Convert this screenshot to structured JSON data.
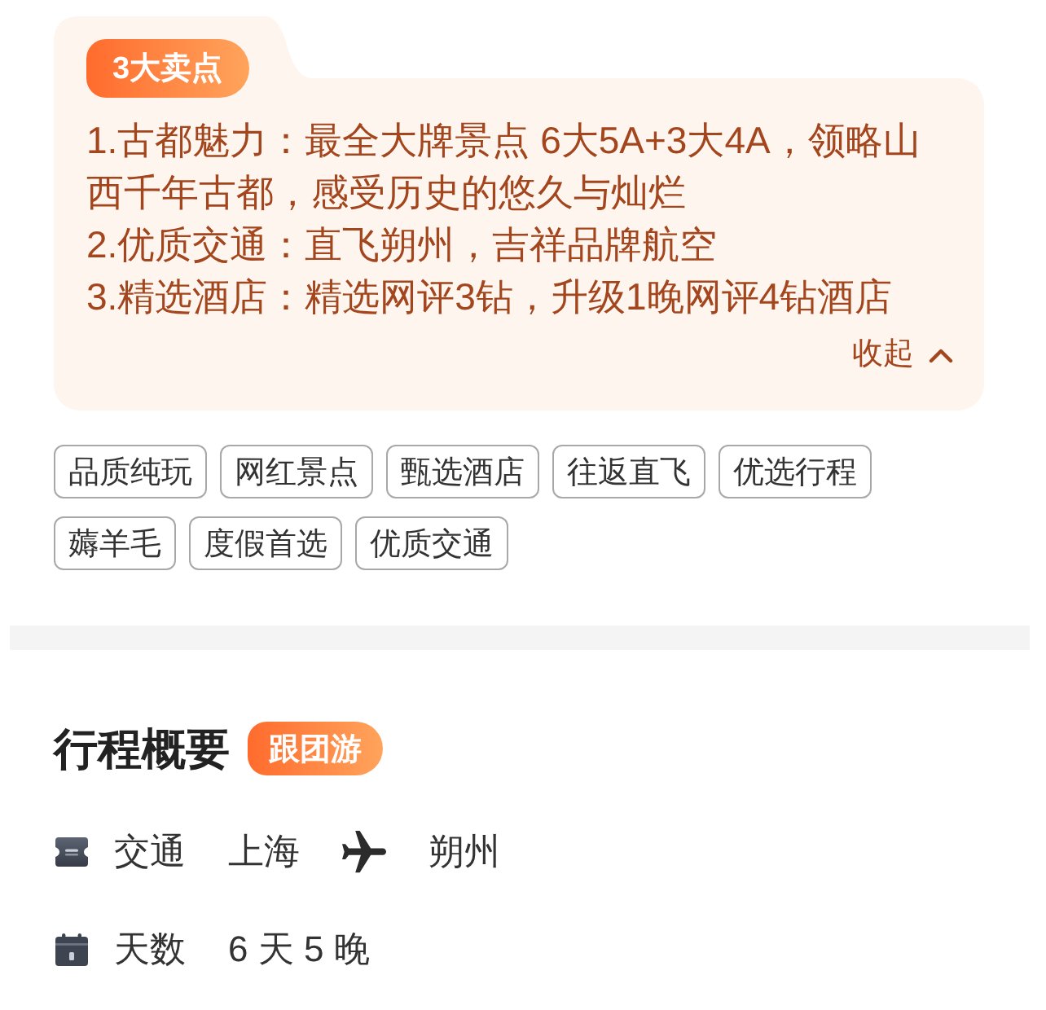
{
  "highlights": {
    "badge": "3大卖点",
    "points": [
      "1.古都魅力：最全大牌景点 6大5A+3大4A，领略山西千年古都，感受历史的悠久与灿烂",
      "2.优质交通：直飞朔州，吉祥品牌航空",
      "3.精选酒店：精选网评3钻，升级1晚网评4钻酒店"
    ],
    "toggle": {
      "label": "收起",
      "expanded": true
    }
  },
  "tags": [
    "品质纯玩",
    "网红景点",
    "甄选酒店",
    "往返直飞",
    "优选行程",
    "薅羊毛",
    "度假首选",
    "优质交通"
  ],
  "overview": {
    "title": "行程概要",
    "badge": "跟团游",
    "rows": [
      {
        "kind": "transport",
        "label": "交通",
        "from": "上海",
        "to": "朔州"
      },
      {
        "kind": "duration",
        "label": "天数",
        "value": "6 天 5 晚"
      }
    ]
  }
}
